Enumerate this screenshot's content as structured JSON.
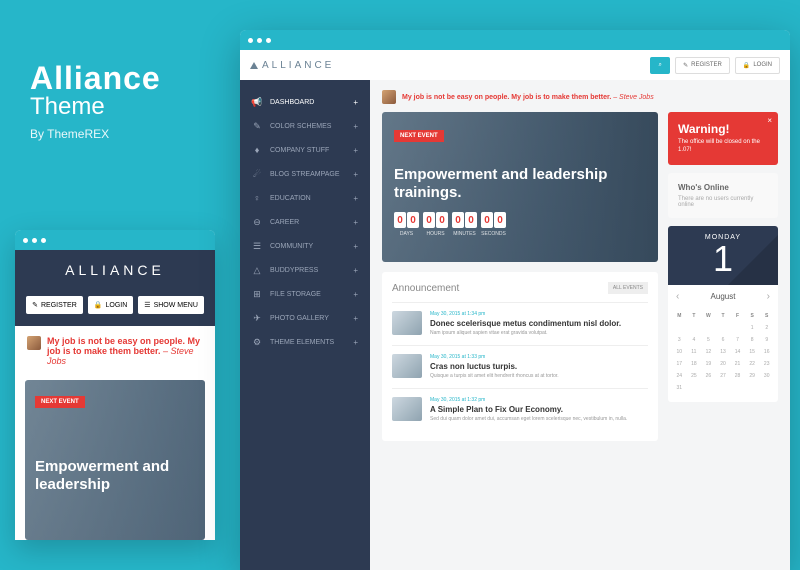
{
  "promo": {
    "title": "Alliance",
    "subtitle": "Theme",
    "byline": "By ThemeREX"
  },
  "brand": "ALLIANCE",
  "buttons": {
    "register": "REGISTER",
    "login": "LOGIN",
    "showmenu": "SHOW MENU"
  },
  "quote": {
    "text": "My job is not be easy on people. My job is to make them better.",
    "author": "– Steve Jobs"
  },
  "hero": {
    "badge": "NEXT EVENT",
    "title_mobile": "Empowerment and leadership",
    "title": "Empowerment and leadership trainings."
  },
  "countdown": [
    {
      "d1": "0",
      "d2": "0",
      "label": "DAYS"
    },
    {
      "d1": "0",
      "d2": "0",
      "label": "HOURS"
    },
    {
      "d1": "0",
      "d2": "0",
      "label": "MINUTES"
    },
    {
      "d1": "0",
      "d2": "0",
      "label": "SECONDS"
    }
  ],
  "sidebar": [
    {
      "icon": "📢",
      "label": "DASHBOARD"
    },
    {
      "icon": "✎",
      "label": "COLOR SCHEMES"
    },
    {
      "icon": "♦",
      "label": "COMPANY STUFF"
    },
    {
      "icon": "☄",
      "label": "BLOG STREAMPAGE"
    },
    {
      "icon": "♀",
      "label": "EDUCATION"
    },
    {
      "icon": "⊖",
      "label": "CAREER"
    },
    {
      "icon": "☰",
      "label": "COMMUNITY"
    },
    {
      "icon": "△",
      "label": "BUDDYPRESS"
    },
    {
      "icon": "⊞",
      "label": "FILE STORAGE"
    },
    {
      "icon": "✈",
      "label": "PHOTO GALLERY"
    },
    {
      "icon": "⚙",
      "label": "THEME ELEMENTS"
    }
  ],
  "announcement": {
    "heading": "Announcement",
    "all": "ALL EVENTS"
  },
  "posts": [
    {
      "meta": "May 30, 2015 at 1:34 pm",
      "title": "Donec scelerisque metus condimentum nisl dolor.",
      "body": "Nam ipsum aliquet sapien vitae erat gravida volutpat."
    },
    {
      "meta": "May 30, 2015 at 1:33 pm",
      "title": "Cras non luctus turpis.",
      "body": "Quisque a turpis sit amet elit hendrerit rhoncus at at tortor."
    },
    {
      "meta": "May 30, 2015 at 1:32 pm",
      "title": "A Simple Plan to Fix Our Economy.",
      "body": "Sed dui quam dolor amet dui, accumsan eget lorem scelerisque nec, vestibulum in, nulla."
    }
  ],
  "warning": {
    "title": "Warning!",
    "body": "The office will be closed on the 1.07!"
  },
  "who": {
    "title": "Who's Online",
    "body": "There are no users currently online"
  },
  "calendar": {
    "dayname": "MONDAY",
    "daynum": "1",
    "month": "August",
    "headers": [
      "M",
      "T",
      "W",
      "T",
      "F",
      "S",
      "S"
    ],
    "cells": [
      "",
      "",
      "",
      "",
      "",
      "1",
      "2",
      "3",
      "4",
      "5",
      "6",
      "7",
      "8",
      "9",
      "10",
      "11",
      "12",
      "13",
      "14",
      "15",
      "16",
      "17",
      "18",
      "19",
      "20",
      "21",
      "22",
      "23",
      "24",
      "25",
      "26",
      "27",
      "28",
      "29",
      "30",
      "31",
      "",
      "",
      "",
      "",
      "",
      ""
    ]
  }
}
